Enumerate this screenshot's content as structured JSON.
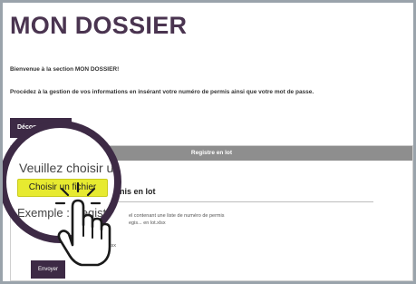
{
  "page": {
    "title": "MON DOSSIER",
    "welcome": "Bienvenue à la section MON DOSSIER!",
    "instructions": "Procédez à la gestion de vos informations en insérant votre numéro de permis ainsi que votre mot de passe."
  },
  "toolbar": {
    "logout_label": "Déconnexion"
  },
  "panel": {
    "header": "Registre en lot",
    "permits_label": "nis en lot",
    "hint_line1": "el contenant une liste de numéro de permis",
    "hint_line2": "egis... en lot.xlsx",
    "extension": ".xlsx",
    "send_label": "Envoyer"
  },
  "overlay": {
    "choose_prompt": "Veuillez choisir un",
    "file_button_label": "Choisir un fichier",
    "example_text": "Exemple : Registre"
  },
  "colors": {
    "brand": "#3d2a45",
    "file_button": "#e7ea30",
    "panel_header": "#8e8e8e"
  }
}
